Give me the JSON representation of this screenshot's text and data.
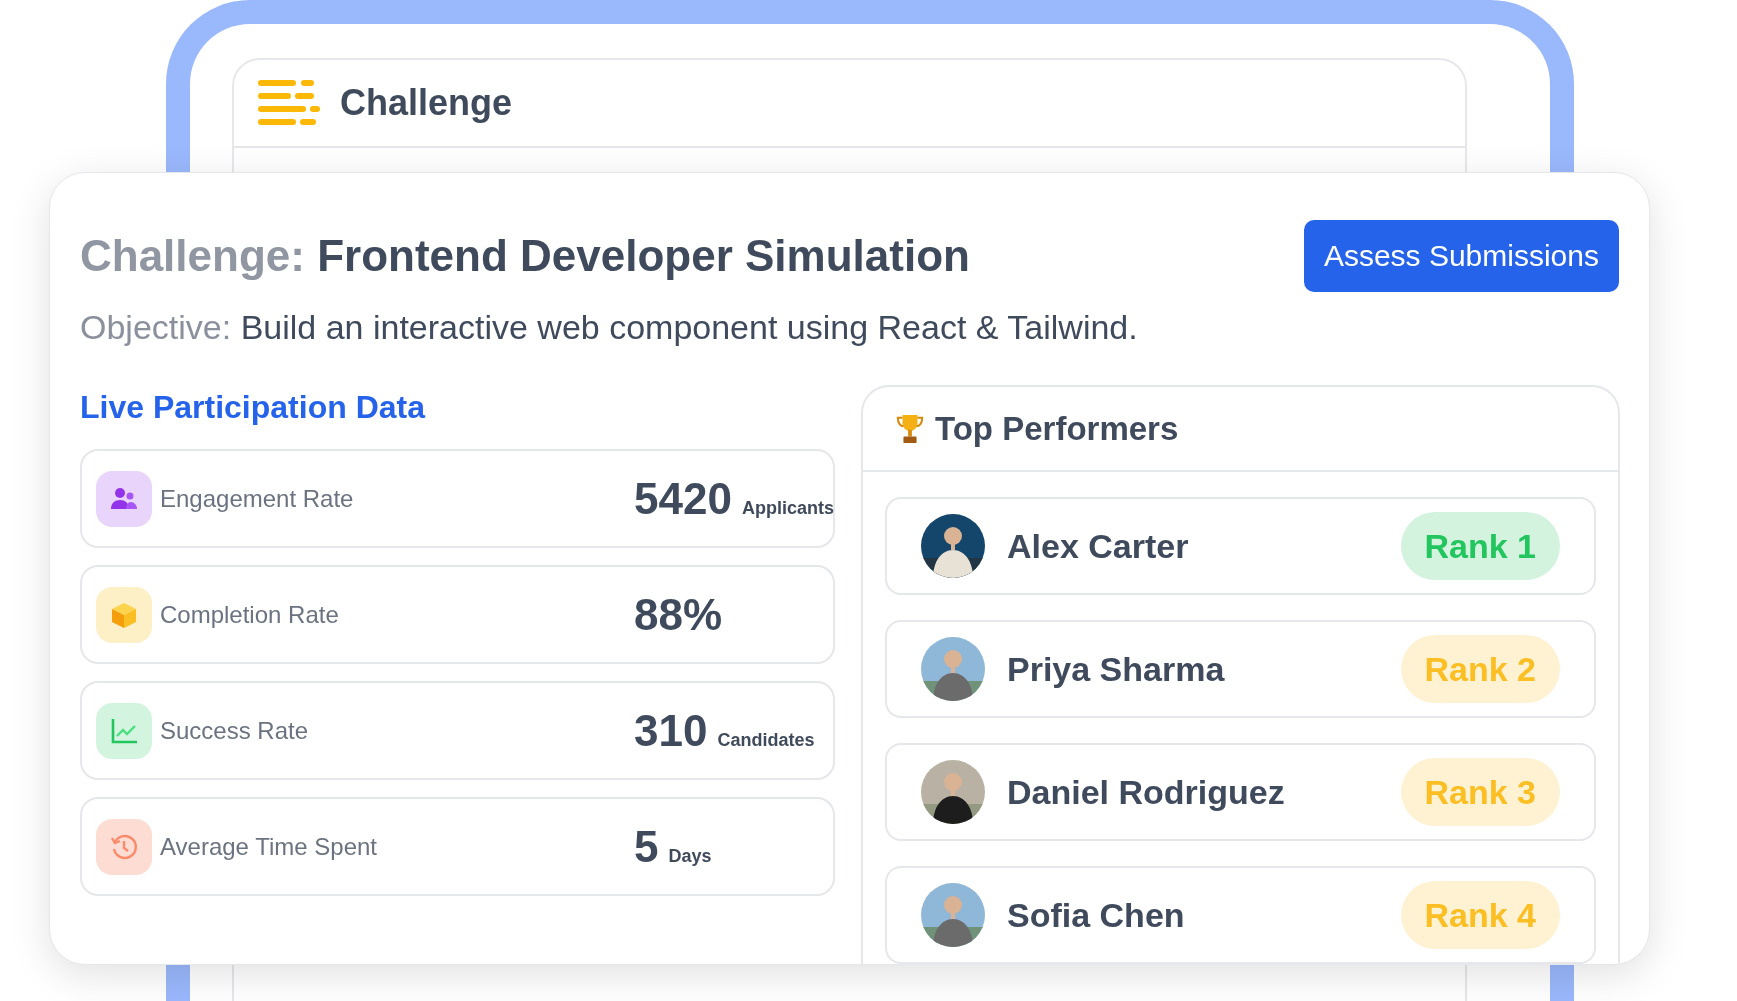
{
  "background_app": {
    "title": "Challenge"
  },
  "challenge": {
    "label": "Challenge:",
    "name": "Frontend Developer Simulation",
    "objective_label": "Objective:",
    "objective": "Build an interactive web component using React & Tailwind."
  },
  "assess_button": "Assess Submissions",
  "participation": {
    "title": "Live Participation Data",
    "stats": [
      {
        "kind": "people",
        "label": "Engagement Rate",
        "value": "5420",
        "unit": "Applicants"
      },
      {
        "kind": "cube",
        "label": "Completion Rate",
        "value": "88%"
      },
      {
        "kind": "chart",
        "label": "Success Rate",
        "value": "310",
        "unit": "Candidates"
      },
      {
        "kind": "clock",
        "label": "Average Time Spent",
        "value": "5",
        "unit": "Days"
      }
    ]
  },
  "top_performers": {
    "title": "Top Performers",
    "items": [
      {
        "name": "Alex Carter",
        "rank": "Rank 1",
        "color": "#22c55e"
      },
      {
        "name": "Priya Sharma",
        "rank": "Rank 2",
        "color": "#fbbf24"
      },
      {
        "name": "Daniel Rodriguez",
        "rank": "Rank 3",
        "color": "#fbbf24"
      },
      {
        "name": "Sofia Chen",
        "rank": "Rank 4",
        "color": "#fbbf24"
      }
    ]
  }
}
